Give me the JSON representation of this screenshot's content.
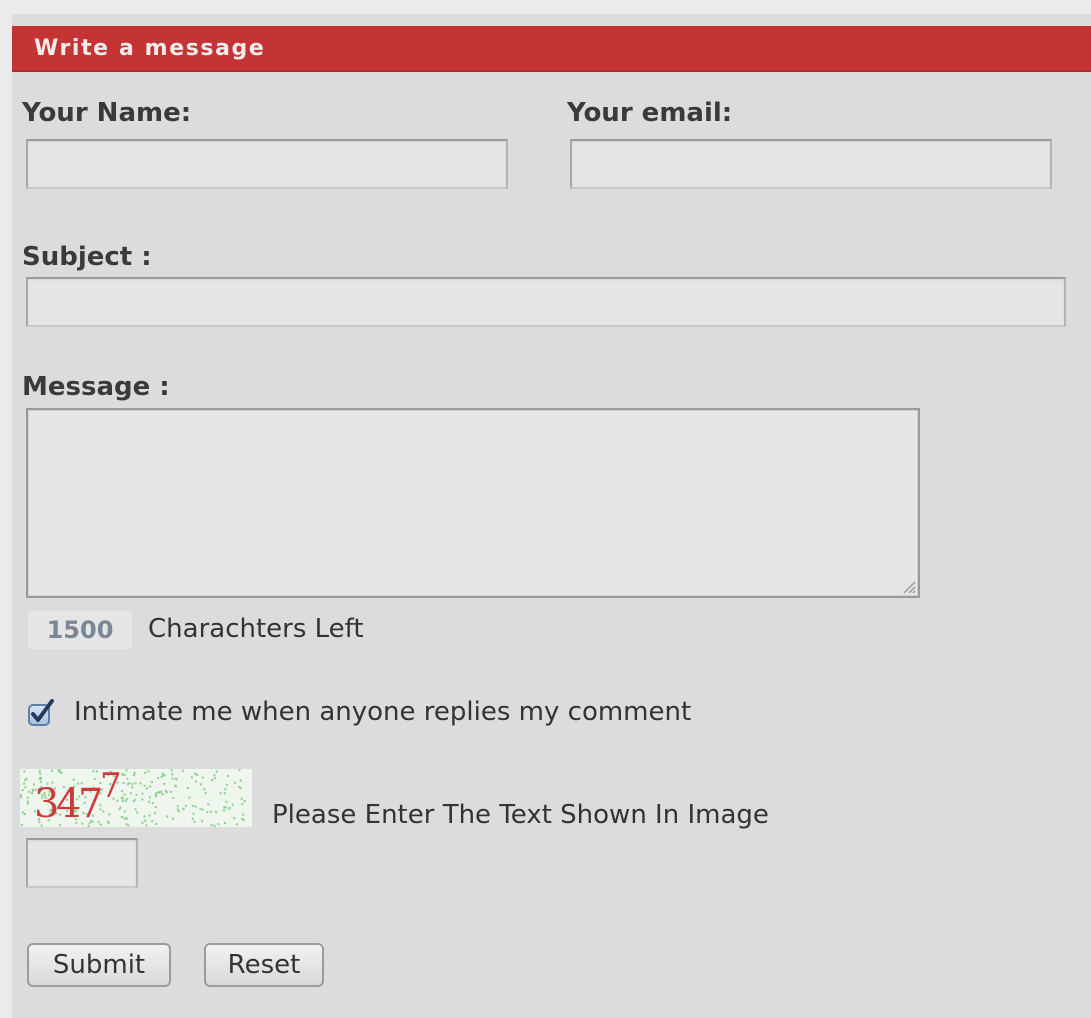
{
  "form": {
    "title": "Write a message",
    "name_label": "Your Name:",
    "email_label": "Your email:",
    "subject_label": "Subject :",
    "message_label": "Message :",
    "chars_left_count": "1500",
    "chars_left_label": "Charachters Left",
    "notify_label": "Intimate me when anyone replies my comment",
    "notify_checked": true,
    "captcha_text": "3477",
    "captcha_prompt": "Please Enter The Text Shown In Image",
    "submit_label": "Submit",
    "reset_label": "Reset"
  },
  "colors": {
    "header_bg": "#c43434",
    "panel_bg": "#dcdcdc",
    "counter_text": "#7a8896",
    "captcha_digits": "#c94040"
  }
}
